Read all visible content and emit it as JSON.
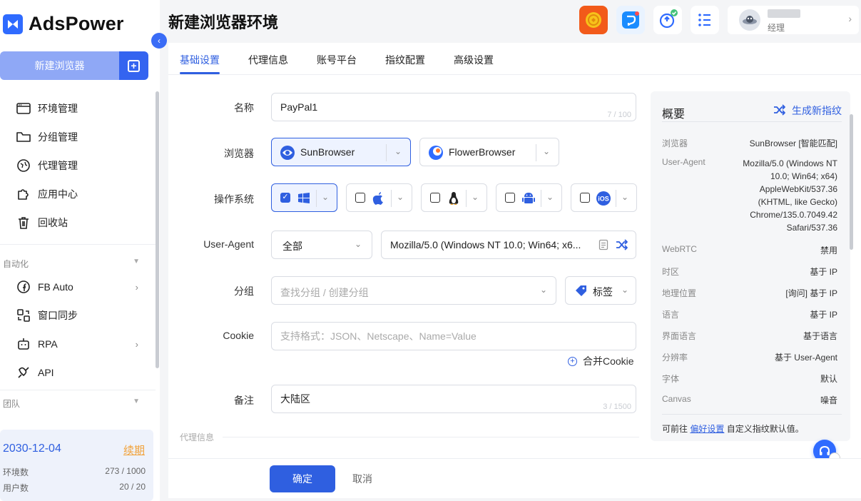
{
  "app": {
    "name": "AdsPower",
    "page_title": "新建浏览器环境"
  },
  "sidebar": {
    "new_browser": "新建浏览器",
    "items": [
      {
        "label": "环境管理"
      },
      {
        "label": "分组管理"
      },
      {
        "label": "代理管理"
      },
      {
        "label": "应用中心"
      },
      {
        "label": "回收站"
      }
    ],
    "automation_title": "自动化",
    "automation_items": [
      {
        "label": "FB Auto"
      },
      {
        "label": "窗口同步"
      },
      {
        "label": "RPA"
      },
      {
        "label": "API"
      }
    ],
    "team_title": "团队",
    "plan": {
      "expire_date": "2030-12-04",
      "renew": "续期",
      "env_label": "环境数",
      "env_value": "273 / 1000",
      "user_label": "用户数",
      "user_value": "20 / 20"
    }
  },
  "header": {
    "user_role": "经理"
  },
  "tabs": [
    "基础设置",
    "代理信息",
    "账号平台",
    "指纹配置",
    "高级设置"
  ],
  "form": {
    "name_label": "名称",
    "name_value": "PayPal1",
    "name_counter": "7 / 100",
    "browser_label": "浏览器",
    "browser_1": "SunBrowser",
    "browser_2": "FlowerBrowser",
    "os_label": "操作系统",
    "ua_label": "User-Agent",
    "ua_filter": "全部",
    "ua_value": "Mozilla/5.0 (Windows NT 10.0; Win64; x6...",
    "group_label": "分组",
    "group_placeholder": "查找分组 / 创建分组",
    "tag_label": "标签",
    "cookie_label": "Cookie",
    "cookie_placeholder": "支持格式：JSON、Netscape、Name=Value",
    "merge_cookie": "合并Cookie",
    "remark_label": "备注",
    "remark_value": "大陆区",
    "remark_counter": "3 / 1500",
    "proxy_section": "代理信息"
  },
  "summary": {
    "title": "概要",
    "generate": "生成新指纹",
    "rows": [
      {
        "key": "浏览器",
        "value": "SunBrowser [智能匹配]"
      },
      {
        "key": "User-Agent",
        "value": "Mozilla/5.0 (Windows NT 10.0; Win64; x64) AppleWebKit/537.36 (KHTML, like Gecko) Chrome/135.0.7049.42 Safari/537.36"
      },
      {
        "key": "WebRTC",
        "value": "禁用"
      },
      {
        "key": "时区",
        "value": "基于 IP"
      },
      {
        "key": "地理位置",
        "value": "[询问] 基于 IP"
      },
      {
        "key": "语言",
        "value": "基于 IP"
      },
      {
        "key": "界面语言",
        "value": "基于语言"
      },
      {
        "key": "分辨率",
        "value": "基于 User-Agent"
      },
      {
        "key": "字体",
        "value": "默认"
      },
      {
        "key": "Canvas",
        "value": "噪音"
      }
    ],
    "footer_pre": "可前往",
    "footer_link": "偏好设置",
    "footer_post": "自定义指纹默认值。"
  },
  "footer": {
    "ok": "确定",
    "cancel": "取消"
  },
  "colors": {
    "accent": "#2f5fe0",
    "brand": "#2f6bff"
  }
}
